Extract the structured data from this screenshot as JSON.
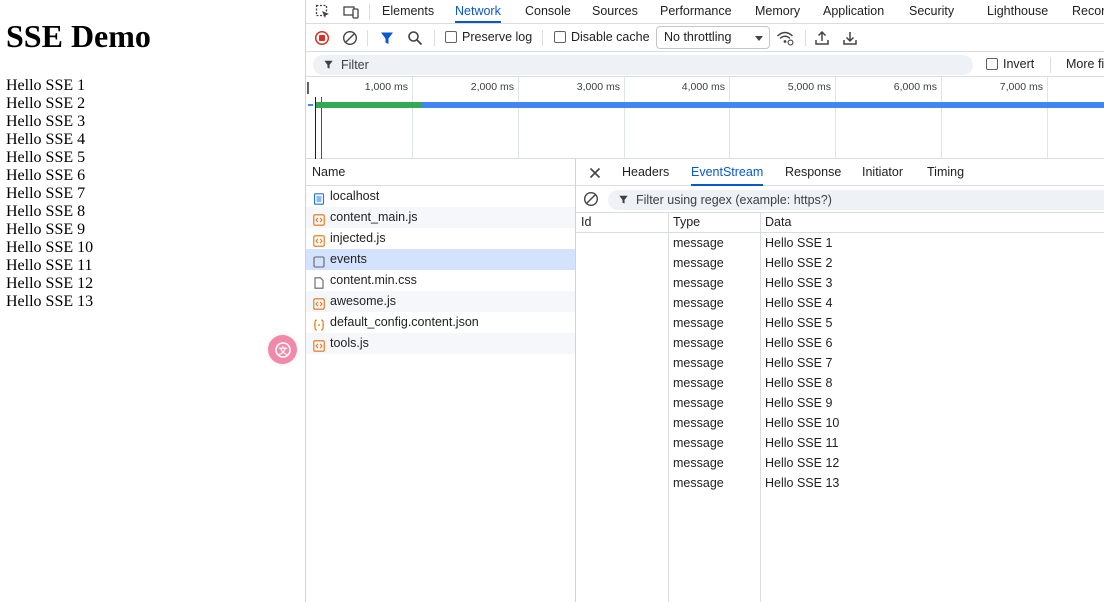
{
  "page": {
    "title": "SSE Demo",
    "lines": [
      "Hello SSE 1",
      "Hello SSE 2",
      "Hello SSE 3",
      "Hello SSE 4",
      "Hello SSE 5",
      "Hello SSE 6",
      "Hello SSE 7",
      "Hello SSE 8",
      "Hello SSE 9",
      "Hello SSE 10",
      "Hello SSE 11",
      "Hello SSE 12",
      "Hello SSE 13"
    ]
  },
  "devtools": {
    "panel_tabs": [
      "Elements",
      "Network",
      "Console",
      "Sources",
      "Performance",
      "Memory",
      "Application",
      "Security",
      "Lighthouse",
      "Recor"
    ],
    "active_panel": "Network",
    "toolbar": {
      "preserve_log": "Preserve log",
      "disable_cache": "Disable cache",
      "throttling": "No throttling"
    },
    "filter": {
      "placeholder": "Filter",
      "invert": "Invert",
      "more_filters": "More fi"
    },
    "timeline": {
      "ticks": [
        "1,000 ms",
        "2,000 ms",
        "3,000 ms",
        "4,000 ms",
        "5,000 ms",
        "6,000 ms",
        "7,000 ms"
      ]
    },
    "requests": {
      "header": "Name",
      "items": [
        {
          "name": "localhost",
          "type": "document"
        },
        {
          "name": "content_main.js",
          "type": "script"
        },
        {
          "name": "injected.js",
          "type": "script"
        },
        {
          "name": "events",
          "type": "eventsource"
        },
        {
          "name": "content.min.css",
          "type": "stylesheet"
        },
        {
          "name": "awesome.js",
          "type": "script"
        },
        {
          "name": "default_config.content.json",
          "type": "json"
        },
        {
          "name": "tools.js",
          "type": "script"
        }
      ],
      "selected": "events"
    },
    "detail_tabs": [
      "Headers",
      "EventStream",
      "Response",
      "Initiator",
      "Timing"
    ],
    "active_detail_tab": "EventStream",
    "eventstream": {
      "filter_placeholder": "Filter using regex (example: https?)",
      "columns": [
        "Id",
        "Type",
        "Data"
      ],
      "rows": [
        {
          "id": "",
          "type": "message",
          "data": "Hello SSE 1"
        },
        {
          "id": "",
          "type": "message",
          "data": "Hello SSE 2"
        },
        {
          "id": "",
          "type": "message",
          "data": "Hello SSE 3"
        },
        {
          "id": "",
          "type": "message",
          "data": "Hello SSE 4"
        },
        {
          "id": "",
          "type": "message",
          "data": "Hello SSE 5"
        },
        {
          "id": "",
          "type": "message",
          "data": "Hello SSE 6"
        },
        {
          "id": "",
          "type": "message",
          "data": "Hello SSE 7"
        },
        {
          "id": "",
          "type": "message",
          "data": "Hello SSE 8"
        },
        {
          "id": "",
          "type": "message",
          "data": "Hello SSE 9"
        },
        {
          "id": "",
          "type": "message",
          "data": "Hello SSE 10"
        },
        {
          "id": "",
          "type": "message",
          "data": "Hello SSE 11"
        },
        {
          "id": "",
          "type": "message",
          "data": "Hello SSE 12"
        },
        {
          "id": "",
          "type": "message",
          "data": "Hello SSE 13"
        }
      ]
    },
    "colors": {
      "accent": "#0b57d0",
      "record": "#d93025",
      "selected_row": "#d3e3fd",
      "timeline_green": "#34a853",
      "timeline_blue": "#4285f4",
      "translate_button": "#f08aa8"
    }
  }
}
